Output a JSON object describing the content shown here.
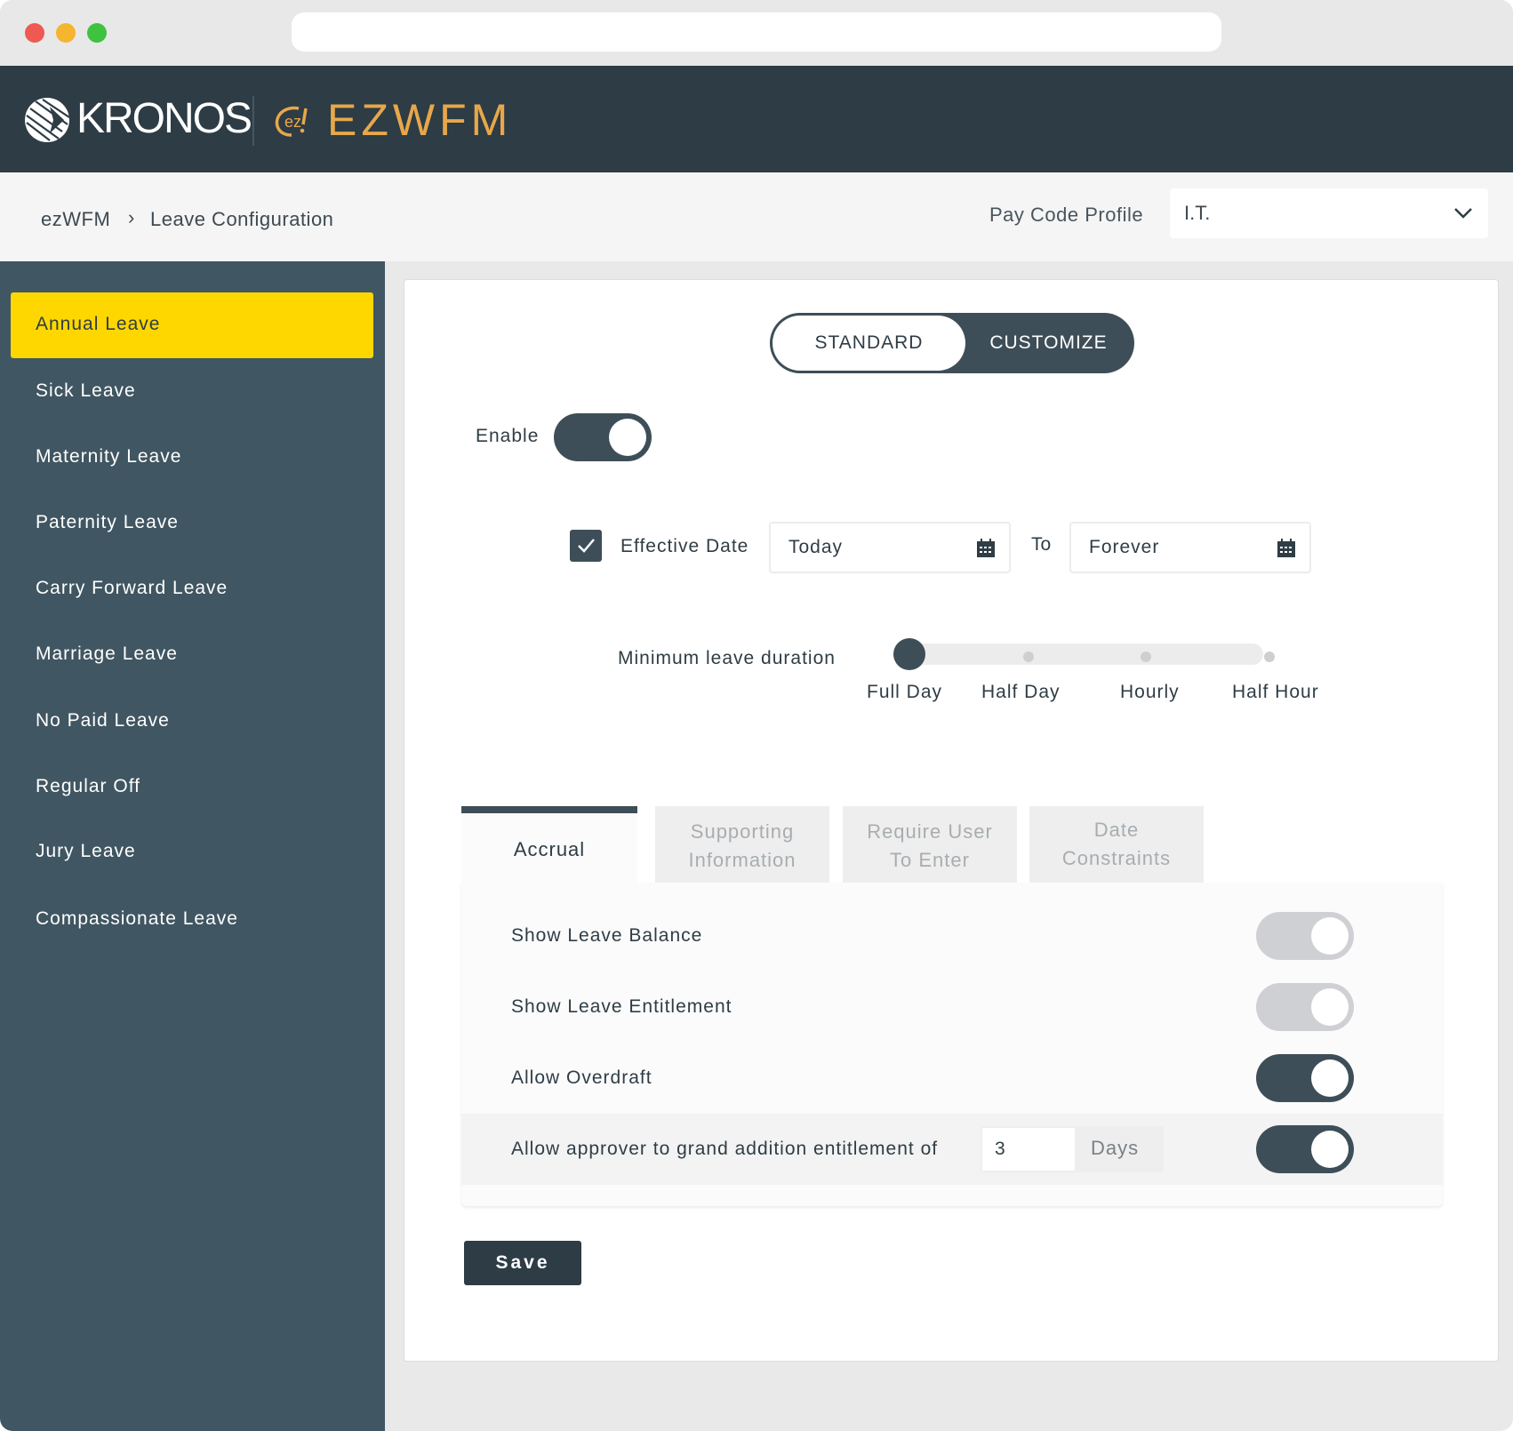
{
  "header": {
    "kronos_logo_text": "KRONOS",
    "kronos_reg": "®",
    "ezwfm_logo_text": "EZWFM"
  },
  "breadcrumb": {
    "root": "ezWFM",
    "separator": "›",
    "current": "Leave Configuration"
  },
  "pay_code_profile": {
    "label": "Pay Code Profile",
    "value": "I.T."
  },
  "sidebar": {
    "items": [
      {
        "label": "Annual Leave",
        "active": true
      },
      {
        "label": "Sick Leave"
      },
      {
        "label": "Maternity Leave"
      },
      {
        "label": "Paternity Leave"
      },
      {
        "label": "Carry Forward Leave"
      },
      {
        "label": "Marriage Leave"
      },
      {
        "label": "No Paid Leave"
      },
      {
        "label": "Regular Off"
      },
      {
        "label": "Jury Leave"
      },
      {
        "label": "Compassionate Leave"
      }
    ]
  },
  "mode": {
    "standard": "STANDARD",
    "customize": "CUSTOMIZE",
    "selected": "CUSTOMIZE"
  },
  "enable": {
    "label": "Enable",
    "on": true
  },
  "effective_date": {
    "checked": true,
    "label": "Effective Date",
    "from": "Today",
    "to_label": "To",
    "to": "Forever"
  },
  "min_duration": {
    "label": "Minimum leave duration",
    "options": [
      "Full Day",
      "Half Day",
      "Hourly",
      "Half Hour"
    ],
    "selected": "Full Day"
  },
  "tabs": [
    {
      "line1": "Accrual",
      "line2": "",
      "active": true
    },
    {
      "line1": "Supporting",
      "line2": "Information"
    },
    {
      "line1": "Require User",
      "line2": "To Enter"
    },
    {
      "line1": "Date",
      "line2": "Constraints"
    }
  ],
  "accrual": {
    "rows": [
      {
        "label": "Show Leave Balance",
        "on": false
      },
      {
        "label": "Show Leave Entitlement",
        "on": false
      },
      {
        "label": "Allow Overdraft",
        "on": true
      },
      {
        "label": "Allow approver to grand addition entitlement of",
        "on": true,
        "amount": "3",
        "unit": "Days"
      }
    ]
  },
  "actions": {
    "save": "Save"
  },
  "colors": {
    "header_bg": "#2d3c45",
    "sidebar_bg": "#405662",
    "active_item": "#ffd700",
    "accent_dark": "#3e4e58",
    "ezwfm_orange": "#e8a74a"
  }
}
